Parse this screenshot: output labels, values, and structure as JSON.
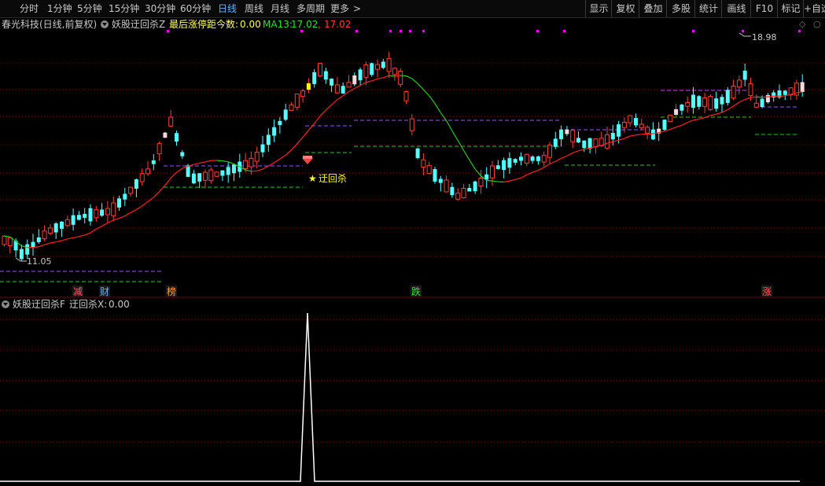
{
  "toolbar": {
    "periods": [
      "分时",
      "1分钟",
      "5分钟",
      "15分钟",
      "30分钟",
      "60分钟",
      "日线",
      "周线",
      "月线",
      "多周期",
      "更多"
    ],
    "active_period": "日线",
    "more_arrow": ">",
    "right_buttons": [
      "显示",
      "复权",
      "叠加",
      "多股",
      "统计",
      "画线",
      "F10",
      "标记",
      "+自选"
    ]
  },
  "header": {
    "stock": "春光科技(日线,前复权)",
    "indicator": "妖股迂回杀Z",
    "limit_label": "最后涨停距今数:",
    "limit_value": "0.00",
    "ma_label": "MA13:",
    "ma_value": "17.02",
    "ma_value2": "17.02"
  },
  "sub_header": {
    "indicator": "妖股迂回杀F",
    "var_label": "迂回杀X:",
    "var_value": "0.00"
  },
  "annotations": {
    "high_price": "18.98",
    "low_price": "11.05",
    "signal_label": "迂回杀",
    "signal_star": "★"
  },
  "event_tags": [
    {
      "text": "减",
      "color": "#ff5a5a"
    },
    {
      "text": "财",
      "color": "#5fb3ff"
    },
    {
      "text": "榜",
      "color": "#ff9a3c"
    },
    {
      "text": "跌",
      "color": "#33dd33"
    },
    {
      "text": "涨",
      "color": "#ff5a5a"
    }
  ],
  "colors": {
    "up": "#ff3c3c",
    "down": "#54ffff",
    "limit_up": "#ffd9d9",
    "signal_bar": "#ffff00",
    "ma13": "#ff2020",
    "ma13_alt": "#22cc22",
    "resistance": "#9955ff",
    "support": "#22cc22",
    "gridline": "#7a0000",
    "magenta_dot": "#ff00ff"
  }
}
